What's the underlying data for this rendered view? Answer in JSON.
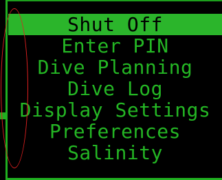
{
  "menu": {
    "items": [
      {
        "label": "Shut Off",
        "selected": true
      },
      {
        "label": "Enter PIN",
        "selected": false
      },
      {
        "label": "Dive Planning",
        "selected": false
      },
      {
        "label": "Dive Log",
        "selected": false
      },
      {
        "label": "Display Settings",
        "selected": false
      },
      {
        "label": "Preferences",
        "selected": false
      },
      {
        "label": "Salinity",
        "selected": false
      }
    ]
  },
  "colors": {
    "background": "#000000",
    "text": "#24b624",
    "highlight": "#2bb52b",
    "annotation": "#e02020"
  }
}
